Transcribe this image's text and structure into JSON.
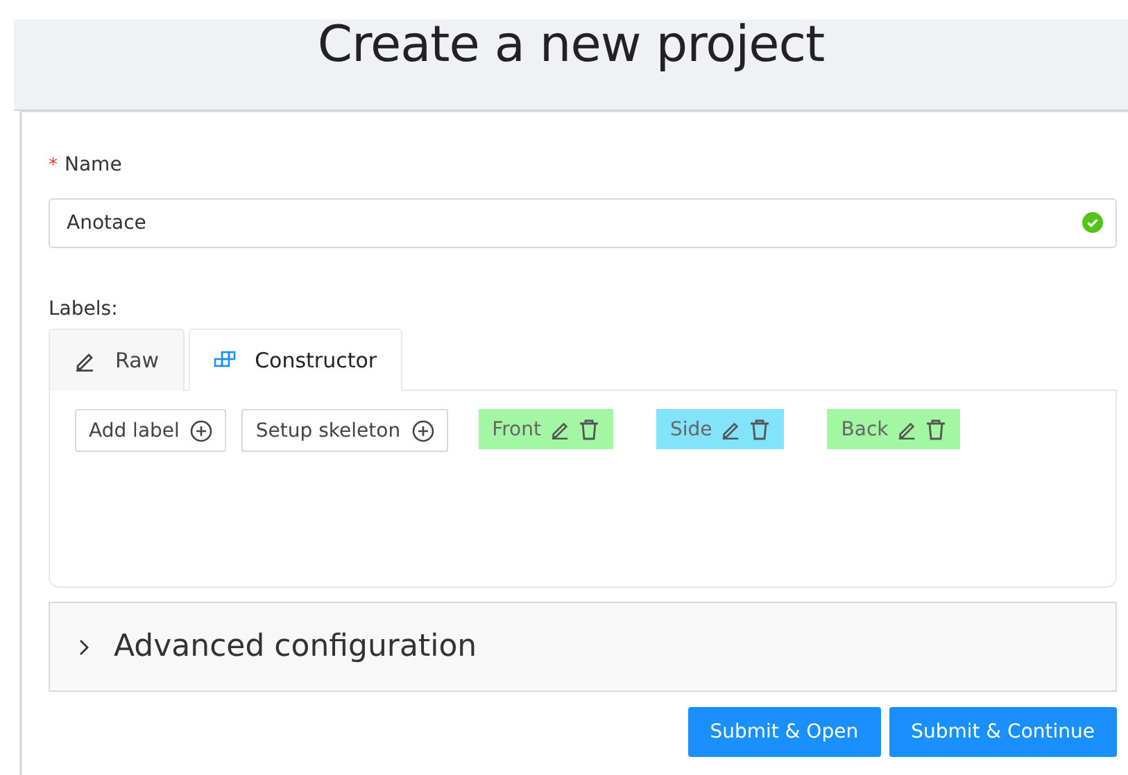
{
  "header": {
    "title": "Create a new project"
  },
  "name_field": {
    "required_mark": "*",
    "label": "Name",
    "value": "Anotace",
    "valid": true
  },
  "labels_section": {
    "label": "Labels:",
    "tabs": [
      {
        "label": "Raw",
        "selected": false,
        "kind": "pencil"
      },
      {
        "label": "Constructor",
        "selected": true,
        "kind": "blocks"
      }
    ],
    "actions": [
      {
        "label": "Add label"
      },
      {
        "label": "Setup skeleton"
      }
    ],
    "tags": [
      {
        "label": "Front",
        "color": "#a3f7a3"
      },
      {
        "label": "Side",
        "color": "#82e3fb"
      },
      {
        "label": "Back",
        "color": "#a3f7a3"
      }
    ]
  },
  "advanced": {
    "title": "Advanced configuration",
    "expanded": false
  },
  "buttons": [
    {
      "label": "Submit & Open"
    },
    {
      "label": "Submit & Continue"
    }
  ]
}
